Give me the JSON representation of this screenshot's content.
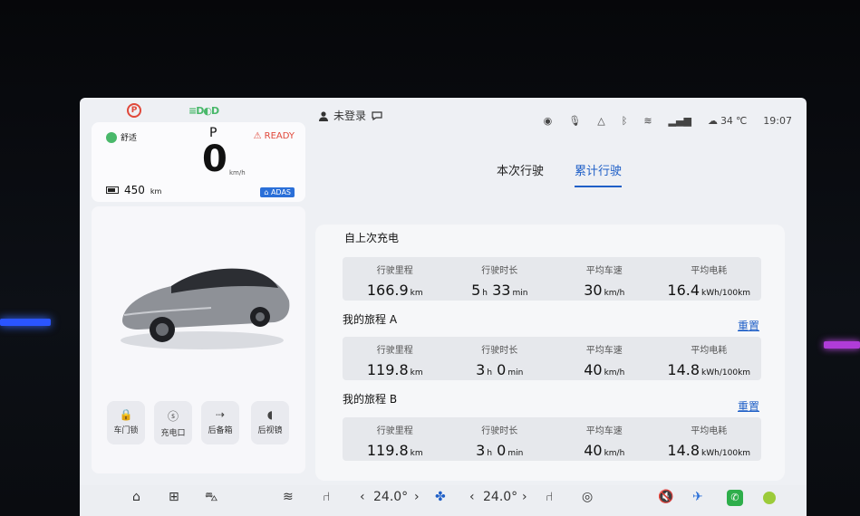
{
  "status_bar": {
    "user_label": "未登录",
    "temperature": "34",
    "temperature_unit": "℃",
    "time": "19:07"
  },
  "drive_panel": {
    "mode": "舒适",
    "gear": "P",
    "speed": "0",
    "speed_unit": "km/h",
    "ready": "READY",
    "range_value": "450",
    "range_unit": "km",
    "adas_label": "ADAS"
  },
  "controls": [
    {
      "label": "车门锁",
      "icon": "lock-icon"
    },
    {
      "label": "充电口",
      "icon": "charge-port-icon"
    },
    {
      "label": "后备箱",
      "icon": "trunk-icon"
    },
    {
      "label": "后视镜",
      "icon": "mirror-icon"
    }
  ],
  "tabs": [
    {
      "label": "本次行驶",
      "active": false
    },
    {
      "label": "累计行驶",
      "active": true
    }
  ],
  "trip_sections": [
    {
      "title": "自上次充电",
      "reset": "",
      "stats": [
        {
          "label": "行驶里程",
          "value": "166.9",
          "unit": "km"
        },
        {
          "label": "行驶时长",
          "value": "5",
          "unit": "h",
          "value2": "33",
          "unit2": "min"
        },
        {
          "label": "平均车速",
          "value": "30",
          "unit": "km/h"
        },
        {
          "label": "平均电耗",
          "value": "16.4",
          "unit": "kWh/100km"
        }
      ]
    },
    {
      "title": "我的旅程 A",
      "reset": "重置",
      "stats": [
        {
          "label": "行驶里程",
          "value": "119.8",
          "unit": "km"
        },
        {
          "label": "行驶时长",
          "value": "3",
          "unit": "h",
          "value2": "0",
          "unit2": "min"
        },
        {
          "label": "平均车速",
          "value": "40",
          "unit": "km/h"
        },
        {
          "label": "平均电耗",
          "value": "14.8",
          "unit": "kWh/100km"
        }
      ]
    },
    {
      "title": "我的旅程 B",
      "reset": "重置",
      "stats": [
        {
          "label": "行驶里程",
          "value": "119.8",
          "unit": "km"
        },
        {
          "label": "行驶时长",
          "value": "3",
          "unit": "h",
          "value2": "0",
          "unit2": "min"
        },
        {
          "label": "平均车速",
          "value": "40",
          "unit": "km/h"
        },
        {
          "label": "平均电耗",
          "value": "14.8",
          "unit": "kWh/100km"
        }
      ]
    }
  ],
  "bottom_bar": {
    "temp_left": "24.0°",
    "temp_right": "24.0°"
  },
  "colors": {
    "accent": "#1f5fc7",
    "ready_red": "#e0483a",
    "light_green": "#49b86a",
    "screen_bg": "#eef0f4"
  }
}
